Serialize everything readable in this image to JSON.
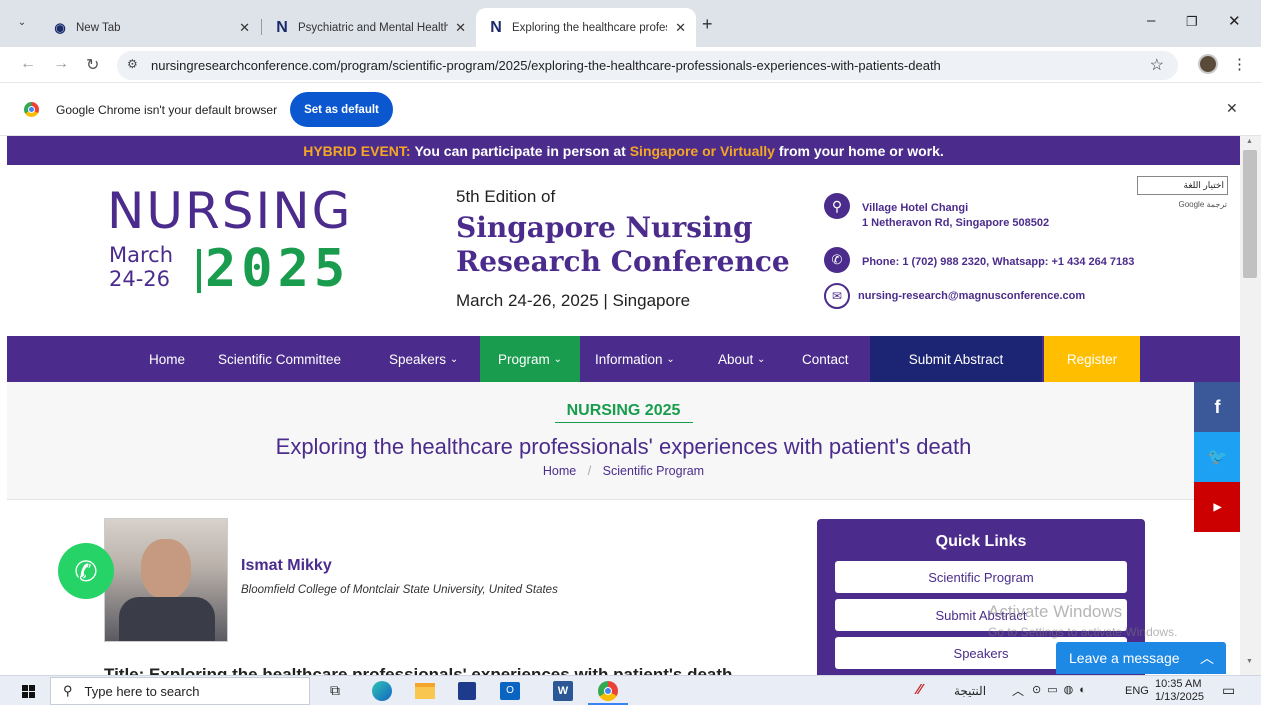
{
  "tabs": [
    {
      "title": "New Tab"
    },
    {
      "title": "Psychiatric and Mental Health N"
    },
    {
      "title": "Exploring the healthcare profess"
    }
  ],
  "browser": {
    "url": "nursingresearchconference.com/program/scientific-program/2025/exploring-the-healthcare-professionals-experiences-with-patients-death",
    "default_msg": "Google Chrome isn't your default browser",
    "set_default": "Set as default"
  },
  "banner": {
    "label": "HYBRID EVENT:",
    "t1": "You can participate in person at",
    "hl": "Singapore or Virtually",
    "t2": "from your home or work."
  },
  "logo": {
    "word": "NURSING",
    "month": "March",
    "days": "24-26",
    "year": "2025"
  },
  "conference": {
    "edition": "5th Edition of",
    "name1": "Singapore Nursing",
    "name2": "Research Conference",
    "dates": "March 24-26, 2025 | Singapore"
  },
  "contact": {
    "venue": "Village Hotel Changi",
    "address": "1 Netheravon Rd, Singapore 508502",
    "phone": "Phone: 1 (702) 988 2320, Whatsapp: +1 434 264 7183",
    "email": "nursing-research@magnusconference.com"
  },
  "translate": {
    "select": "اختيار اللغة",
    "powered": "Google ترجمة"
  },
  "menu": {
    "home": "Home",
    "committee": "Scientific Committee",
    "speakers": "Speakers",
    "program": "Program",
    "information": "Information",
    "about": "About",
    "contact": "Contact",
    "submit": "Submit Abstract",
    "register": "Register"
  },
  "page": {
    "tag": "NURSING 2025",
    "title": "Exploring the healthcare professionals' experiences with patient's death",
    "bc_home": "Home",
    "bc_sep": "/",
    "bc_program": "Scientific Program"
  },
  "speaker": {
    "name": "Ismat Mikky",
    "affiliation": "Bloomfield College of Montclair State University, United States",
    "title_line": "Title: Exploring the healthcare professionals' experiences with patient's death"
  },
  "quick": {
    "heading": "Quick Links",
    "l1": "Scientific Program",
    "l2": "Submit Abstract",
    "l3": "Speakers"
  },
  "overlay": {
    "activate1": "Activate Windows",
    "activate2": "Go to Settings to activate Windows.",
    "chat": "Leave a message"
  },
  "taskbar": {
    "search": "Type here to search",
    "result": "النتيجة",
    "lang": "ENG",
    "time": "10:35 AM",
    "date": "1/13/2025"
  },
  "colors": {
    "purple": "#4b2c8c",
    "green": "#1a9c4e",
    "orange": "#f5a623",
    "navy": "#1b2573",
    "yellow": "#ffbf00"
  }
}
